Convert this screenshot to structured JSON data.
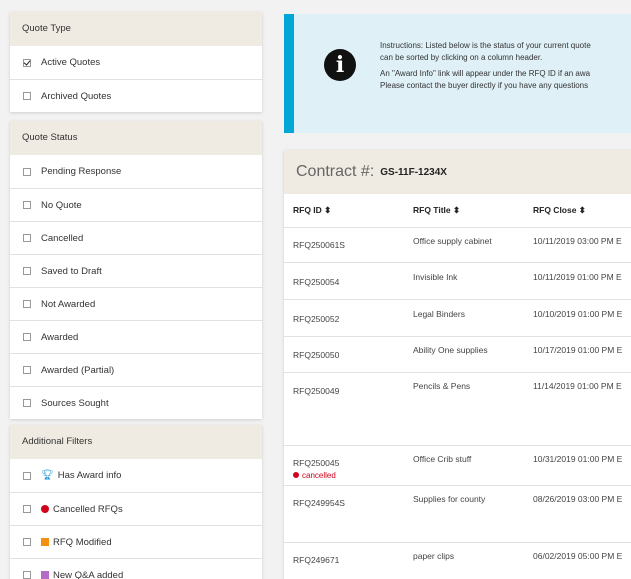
{
  "sidebar": {
    "quote_type": {
      "title": "Quote Type",
      "items": [
        {
          "label": "Active Quotes",
          "checked": true
        },
        {
          "label": "Archived Quotes",
          "checked": false
        }
      ]
    },
    "quote_status": {
      "title": "Quote Status",
      "items": [
        {
          "label": "Pending Response"
        },
        {
          "label": "No Quote"
        },
        {
          "label": "Cancelled"
        },
        {
          "label": "Saved to Draft"
        },
        {
          "label": "Not Awarded"
        },
        {
          "label": "Awarded"
        },
        {
          "label": "Awarded (Partial)"
        },
        {
          "label": "Sources Sought"
        }
      ]
    },
    "additional_filters": {
      "title": "Additional Filters",
      "items": [
        {
          "label": "Has Award info",
          "icon": "trophy-icon",
          "color": "#1e90d6"
        },
        {
          "label": "Cancelled RFQs",
          "icon": "red-dot-icon",
          "color": "#d0021b"
        },
        {
          "label": "RFQ Modified",
          "icon": "orange-square-icon",
          "color": "#f5900a"
        },
        {
          "label": "New Q&A added",
          "icon": "purple-square-icon",
          "color": "#b36bc6"
        }
      ]
    }
  },
  "instructions": {
    "line1": "Instructions: Listed below is the status of your current quote",
    "line2": "can be sorted by clicking on a column header.",
    "line3": "An \"Award Info\" link will appear under the RFQ ID if an awa",
    "line4": "Please contact the buyer directly if you have any questions"
  },
  "contract": {
    "label": "Contract #:",
    "number": "GS-11F-1234X"
  },
  "table": {
    "headers": [
      "RFQ ID ⬍",
      "RFQ Title ⬍",
      "RFQ Close ⬍"
    ],
    "rows": [
      {
        "id": "RFQ250061S",
        "title": "Office supply cabinet",
        "close": "10/11/2019 03:00 PM E"
      },
      {
        "id": "RFQ250054",
        "title": "Invisible Ink",
        "close": "10/11/2019 01:00 PM E"
      },
      {
        "id": "RFQ250052",
        "title": "Legal Binders",
        "close": "10/10/2019 01:00 PM E"
      },
      {
        "id": "RFQ250050",
        "title": "Ability One supplies",
        "close": "10/17/2019 01:00 PM E"
      },
      {
        "id": "RFQ250049",
        "title": "Pencils & Pens",
        "close": "11/14/2019 01:00 PM E"
      },
      {
        "id": "RFQ250045",
        "title": "Office Crib stuff",
        "close": "10/31/2019 01:00 PM E",
        "status": "cancelled"
      },
      {
        "id": "RFQ249954S",
        "title": "Supplies for county",
        "close": "08/26/2019 03:00 PM E"
      },
      {
        "id": "RFQ249671",
        "title": "paper clips",
        "close": "06/02/2019 05:00 PM E"
      }
    ]
  },
  "colors": {
    "accent": "#00a6d6",
    "header_bg": "#efebe2",
    "cancelled": "#d0021b"
  }
}
